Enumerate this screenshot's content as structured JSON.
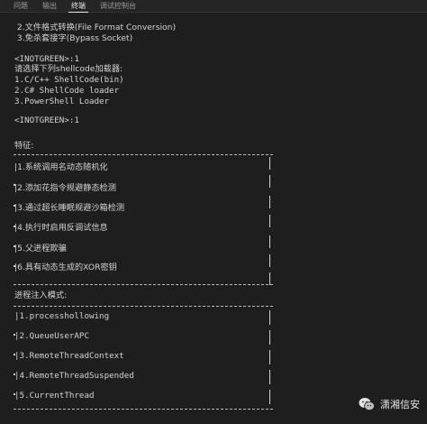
{
  "tabs": [
    {
      "label": "问题"
    },
    {
      "label": "输出"
    },
    {
      "label": "终端"
    },
    {
      "label": "调试控制台"
    }
  ],
  "terminal": {
    "lines": {
      "l1": " 2.文件格式转换(File Format Conversion)",
      "l2": " 3.免杀套接字(Bypass Socket)",
      "l3": "<INOTGREEN>:1",
      "l4": "请选择下列shellcode加载器:",
      "l5": "1.C/C++ ShellCode(bin)",
      "l6": "2.C# ShellCode loader",
      "l7": "3.PowerShell Loader",
      "l8": "<INOTGREEN>:1",
      "l9": "特征:",
      "l10": "进程注入模式:"
    },
    "features": [
      "|1.系统调用名动态随机化",
      "|2.添加花指令规避静态检测",
      "|3.通过超长睡眠规避沙箱检测",
      "|4.执行时启用反调试信息",
      "|5.父进程欺骗",
      "|6.具有动态生成的XOR密钥"
    ],
    "injection_modes": [
      "|1.processhollowing",
      "|2.QueueUserAPC",
      "|3.RemoteThreadContext",
      "|4.RemoteThreadSuspended",
      "|5.CurrentThread"
    ]
  },
  "watermark": {
    "text": "潇湘信安",
    "icon": "wechat-icon"
  }
}
